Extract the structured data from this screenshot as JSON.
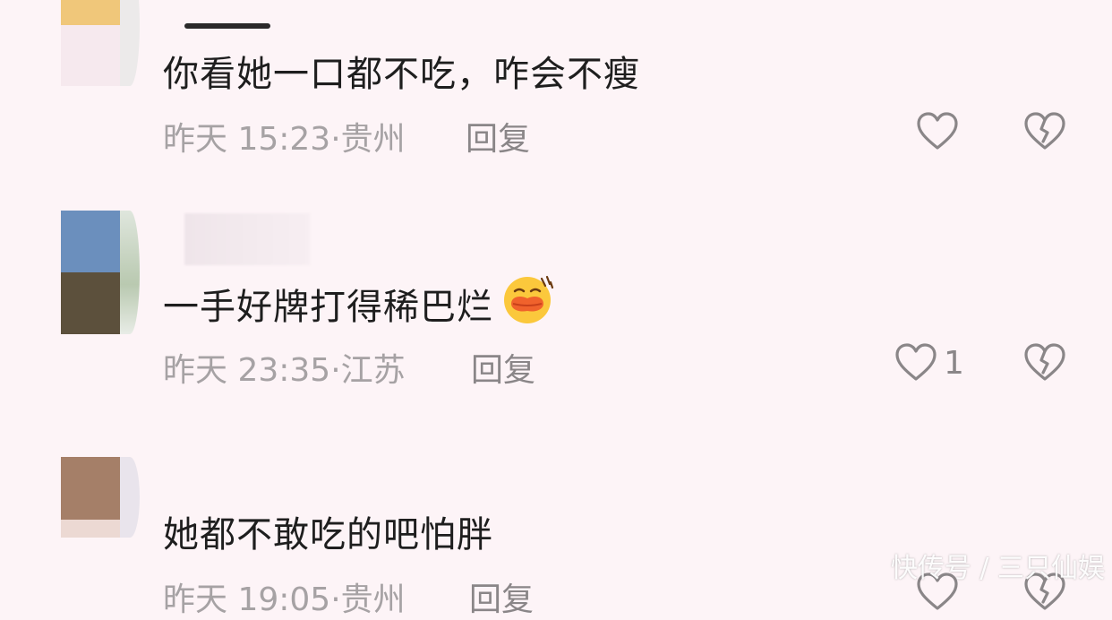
{
  "comments": [
    {
      "text": "你看她一口都不吃，咋会不瘦",
      "time": "昨天 15:23",
      "location": "贵州",
      "reply_label": "回复",
      "like_count": ""
    },
    {
      "text": "一手好牌打得稀巴烂",
      "emoji": "hot-face-emoji",
      "time": "昨天 23:35",
      "location": "江苏",
      "reply_label": "回复",
      "like_count": "1"
    },
    {
      "text": "她都不敢吃的吧怕胖",
      "time": "昨天 19:05",
      "location": "贵州",
      "reply_label": "回复",
      "like_count": ""
    }
  ],
  "icons": {
    "like": "heart-outline-icon",
    "dislike": "broken-heart-icon"
  },
  "colors": {
    "background": "#fdf4f7",
    "text": "#1e1e1e",
    "meta": "#a6a2a4",
    "icon": "#8a8688"
  },
  "watermark": "快传号 / 三只仙娱"
}
